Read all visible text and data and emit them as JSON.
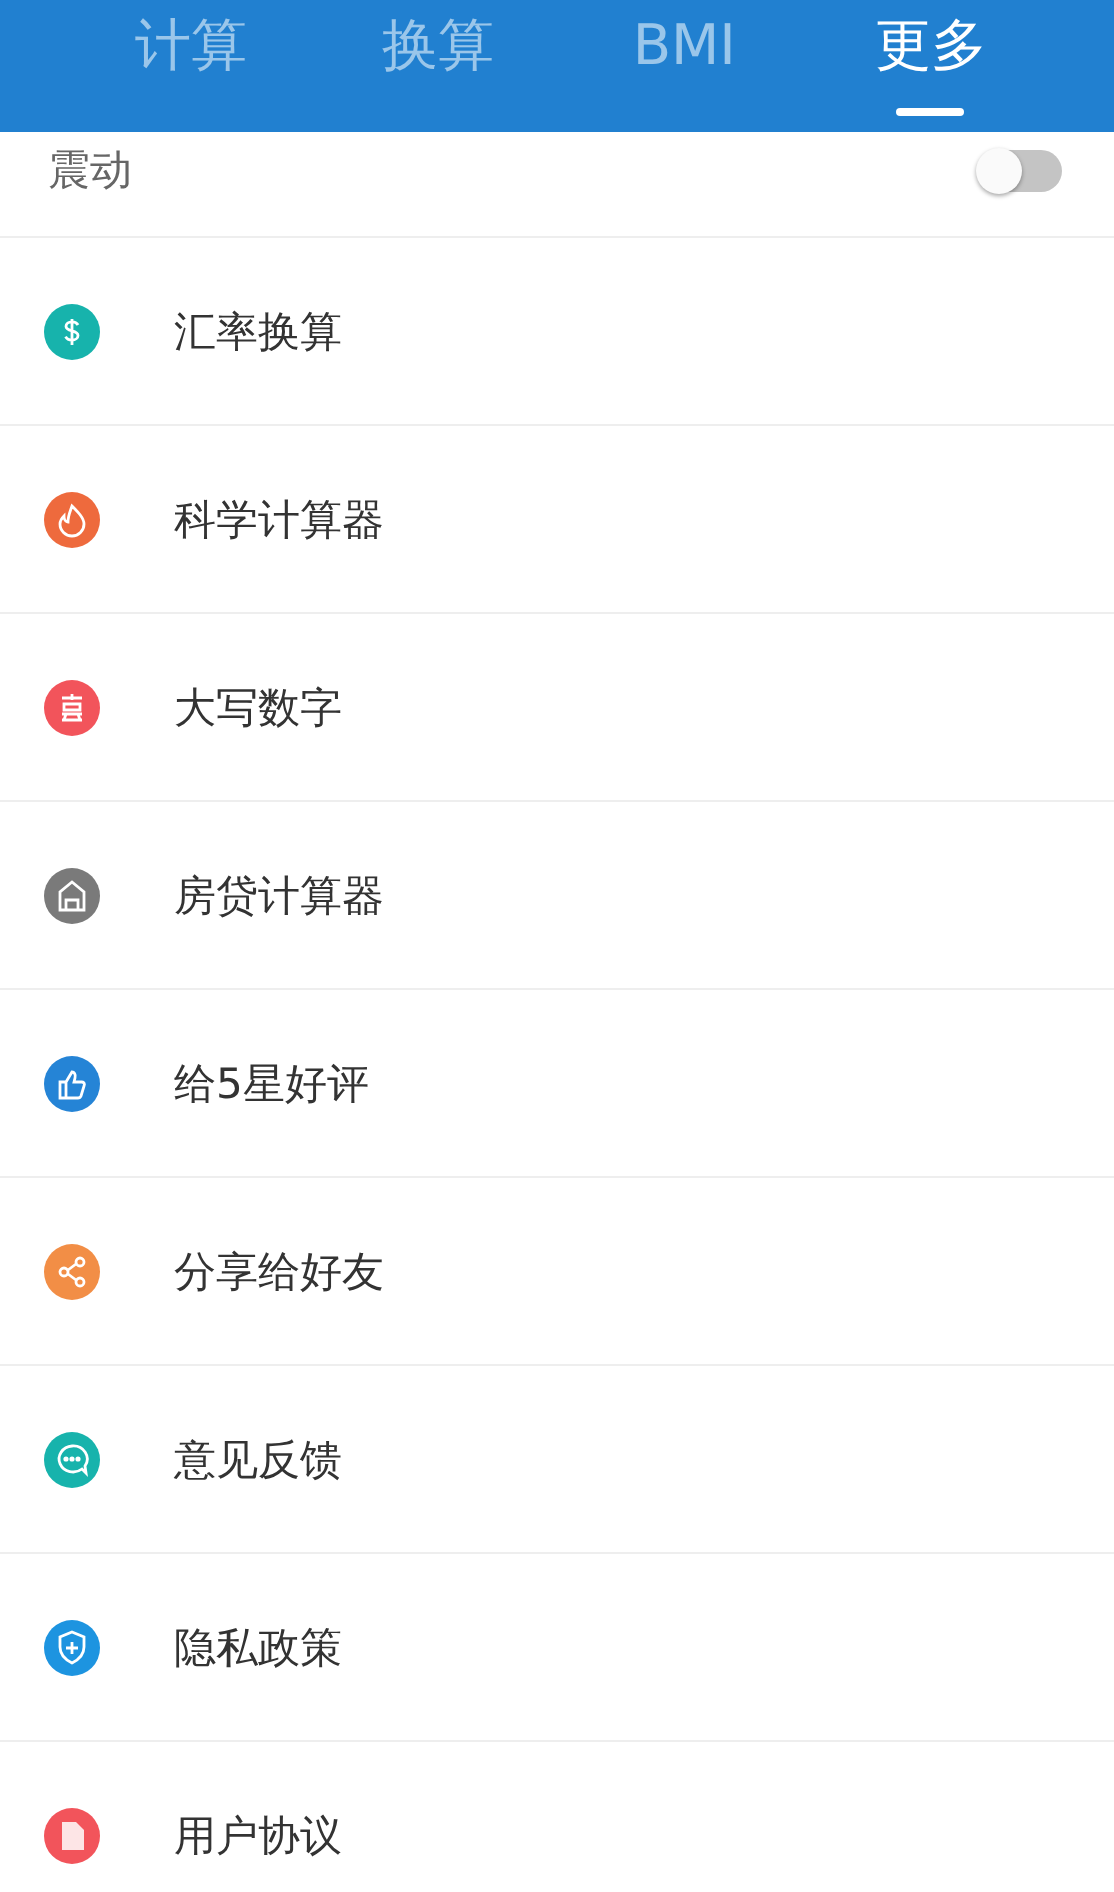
{
  "tabs": [
    {
      "label": "计算",
      "selected": false
    },
    {
      "label": "换算",
      "selected": false
    },
    {
      "label": "BMI",
      "selected": false
    },
    {
      "label": "更多",
      "selected": true
    }
  ],
  "vibration": {
    "label": "震动",
    "on": false
  },
  "items": [
    {
      "label": "汇率换算",
      "kind": "dollar",
      "color": "#17b3ac"
    },
    {
      "label": "科学计算器",
      "kind": "flame",
      "color": "#ee6a3d"
    },
    {
      "label": "大写数字",
      "kind": "numeral",
      "color": "#f2545b"
    },
    {
      "label": "房贷计算器",
      "kind": "house",
      "color": "#7a7a7a"
    },
    {
      "label": "给5星好评",
      "kind": "thumb",
      "color": "#2584d6"
    },
    {
      "label": "分享给好友",
      "kind": "share",
      "color": "#f28e46"
    },
    {
      "label": "意见反馈",
      "kind": "chat",
      "color": "#17b3ac"
    },
    {
      "label": "隐私政策",
      "kind": "shield",
      "color": "#1d94e0"
    },
    {
      "label": "用户协议",
      "kind": "document",
      "color": "#f2545b"
    }
  ]
}
